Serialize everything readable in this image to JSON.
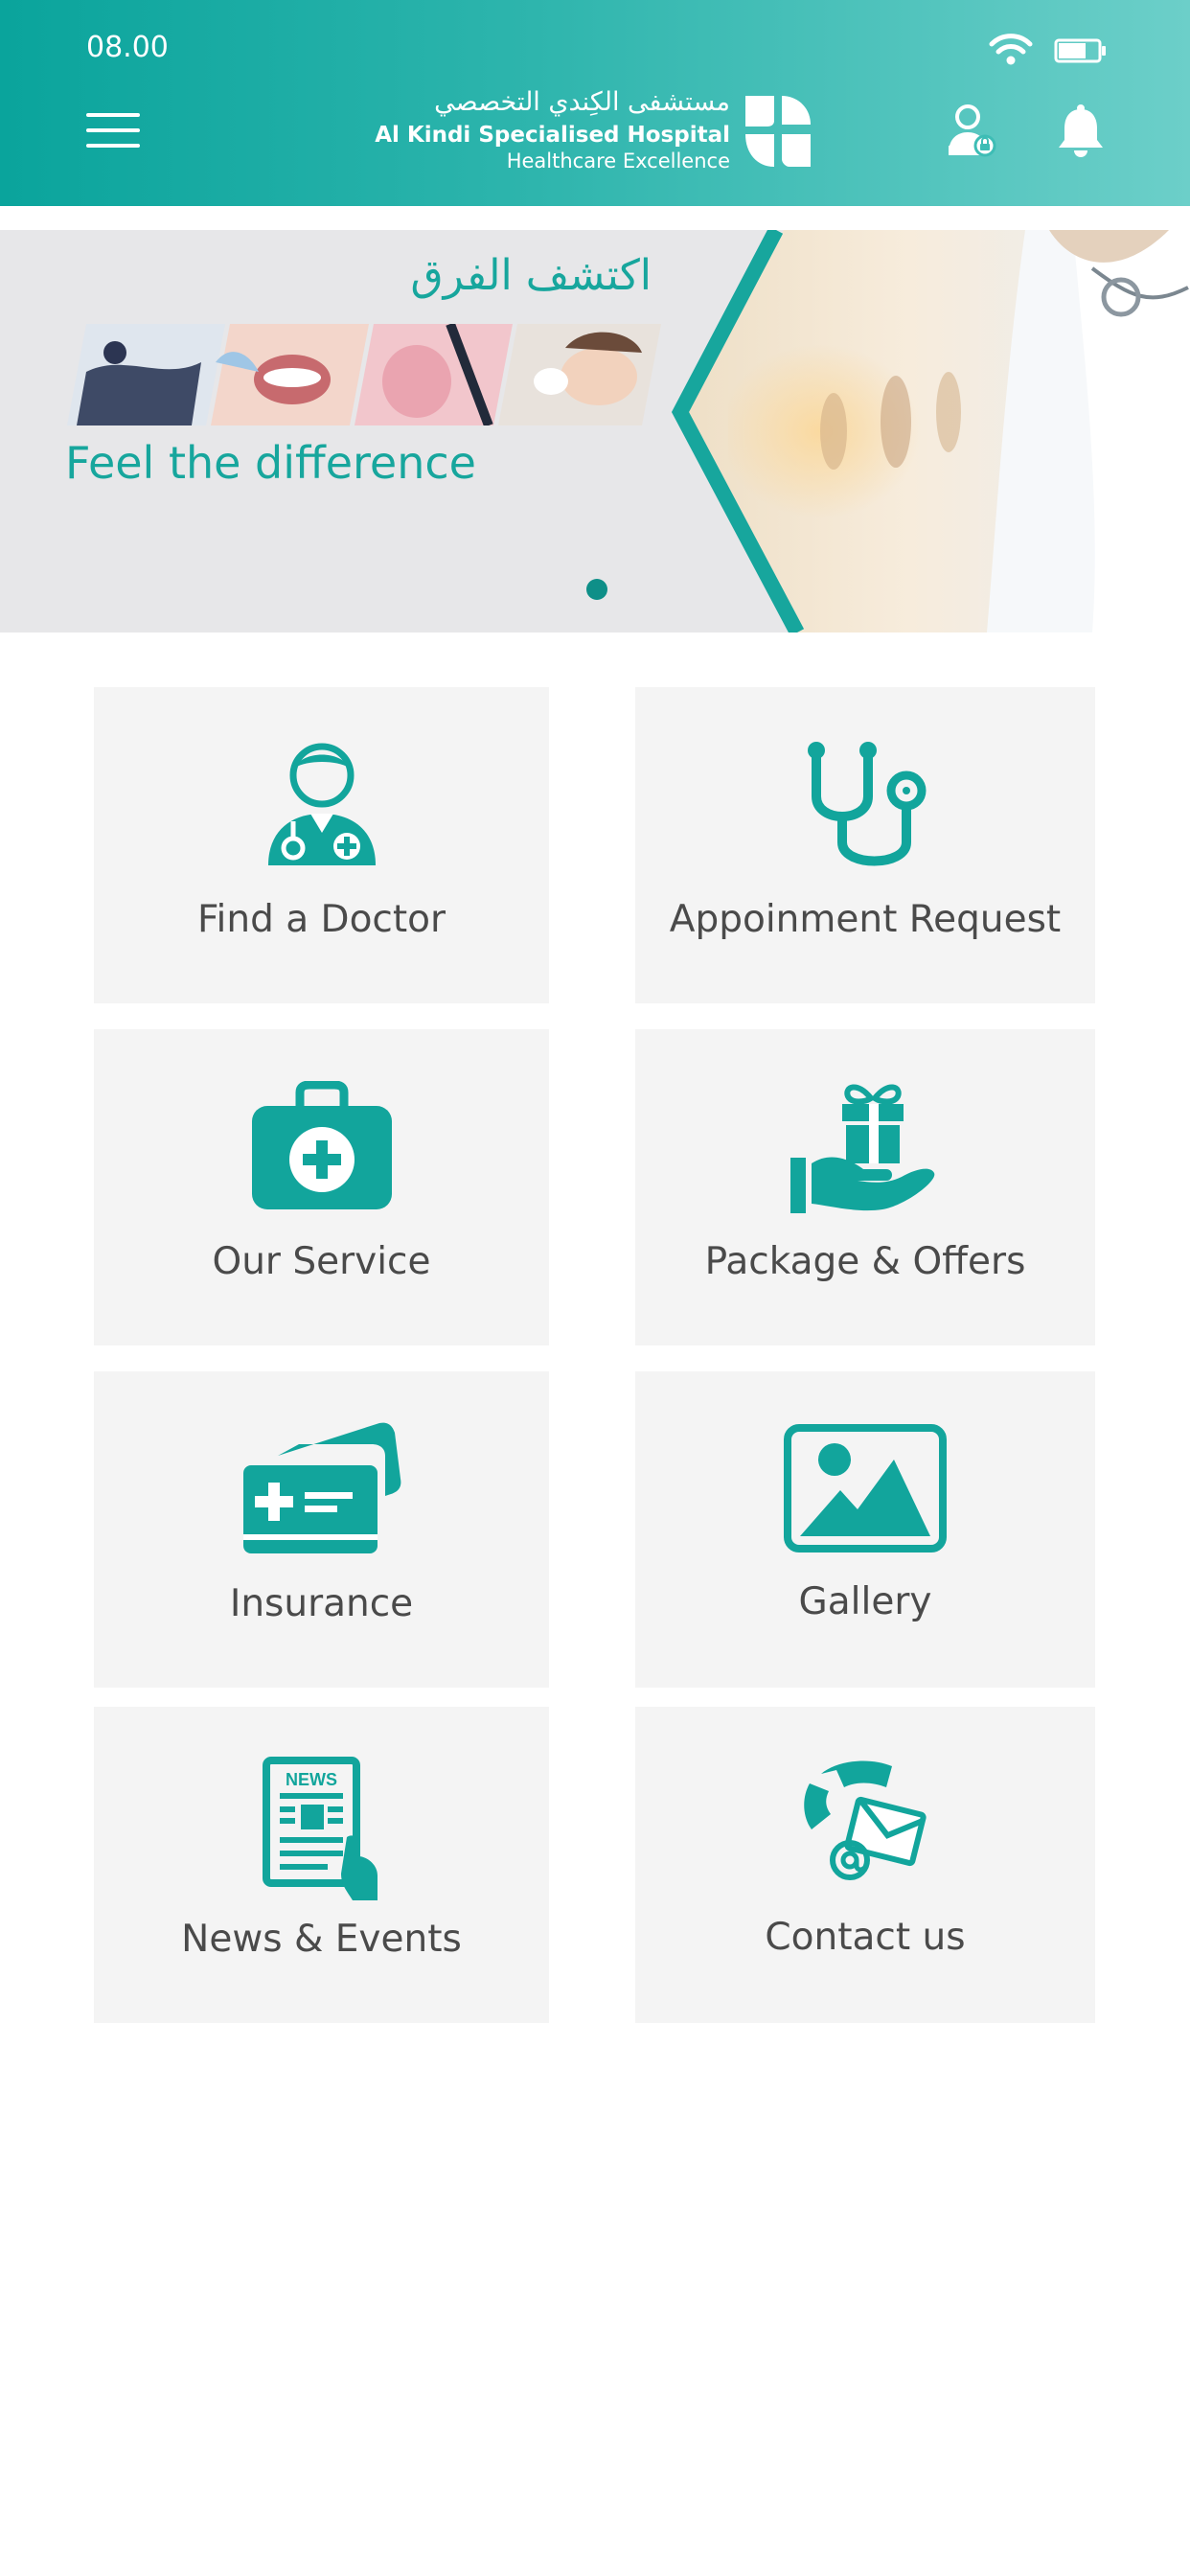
{
  "status_bar": {
    "time": "08.00",
    "wifi_icon": "wifi-icon",
    "battery_icon": "battery-icon"
  },
  "header": {
    "menu_icon": "hamburger-menu-icon",
    "logo": {
      "arabic_name": "مستشفى الكِندي التخصصي",
      "name": "Al Kindi Specialised Hospital",
      "tagline": "Healthcare Excellence"
    },
    "profile_icon": "doctor-profile-icon",
    "notification_icon": "bell-icon"
  },
  "banner": {
    "arabic_text": "اكتشف الفرق",
    "tagline": "Feel the difference",
    "slide_count": 1,
    "active_slide": 1
  },
  "tiles": [
    {
      "label": "Find a Doctor",
      "icon": "doctor-icon"
    },
    {
      "label": "Appoinment Request",
      "icon": "stethoscope-icon"
    },
    {
      "label": "Our Service",
      "icon": "medical-kit-icon"
    },
    {
      "label": "Package & Offers",
      "icon": "gift-hand-icon"
    },
    {
      "label": "Insurance",
      "icon": "insurance-card-icon"
    },
    {
      "label": "Gallery",
      "icon": "gallery-image-icon"
    },
    {
      "label": "News & Events",
      "icon": "newspaper-icon"
    },
    {
      "label": "Contact us",
      "icon": "phone-envelope-icon"
    }
  ],
  "colors": {
    "brand_teal": "#0aa49c",
    "header_gradient_end": "#6ccfc9",
    "icon_teal": "#12a59c",
    "tile_background": "#f4f4f4",
    "tile_text": "#4a4a4a",
    "banner_background": "#e7e7e9"
  }
}
